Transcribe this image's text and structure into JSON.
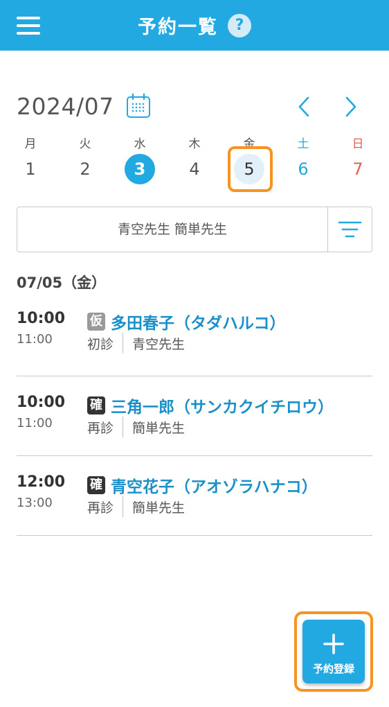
{
  "header": {
    "title": "予約一覧",
    "help_label": "?"
  },
  "calendar": {
    "month": "2024/07",
    "days": [
      {
        "weekday": "月",
        "date": "1"
      },
      {
        "weekday": "火",
        "date": "2"
      },
      {
        "weekday": "水",
        "date": "3"
      },
      {
        "weekday": "木",
        "date": "4"
      },
      {
        "weekday": "金",
        "date": "5"
      },
      {
        "weekday": "土",
        "date": "6"
      },
      {
        "weekday": "日",
        "date": "7"
      }
    ]
  },
  "filter": {
    "value": "青空先生 簡単先生"
  },
  "schedule": {
    "date_heading": "07/05（金）",
    "appointments": [
      {
        "start": "10:00",
        "end": "11:00",
        "badge": "仮",
        "status": "tentative",
        "name": "多田春子（タダハルコ）",
        "visit_type": "初診",
        "doctor": "青空先生"
      },
      {
        "start": "10:00",
        "end": "11:00",
        "badge": "確",
        "status": "confirmed",
        "name": "三角一郎（サンカクイチロウ）",
        "visit_type": "再診",
        "doctor": "簡単先生"
      },
      {
        "start": "12:00",
        "end": "13:00",
        "badge": "確",
        "status": "confirmed",
        "name": "青空花子（アオゾラハナコ）",
        "visit_type": "再診",
        "doctor": "簡単先生"
      }
    ]
  },
  "fab": {
    "label": "予約登録"
  },
  "colors": {
    "primary": "#22a9e2",
    "highlight": "#f7931e",
    "saturday": "#22a9e2",
    "sunday": "#e2614d",
    "tentative_badge": "#9a9a9a",
    "confirmed_badge": "#333333"
  },
  "icons": {
    "menu": "hamburger-menu-icon",
    "help": "question-mark-icon",
    "calendar": "calendar-icon",
    "prev": "chevron-left-icon",
    "next": "chevron-right-icon",
    "filter": "filter-icon",
    "add": "plus-icon"
  }
}
